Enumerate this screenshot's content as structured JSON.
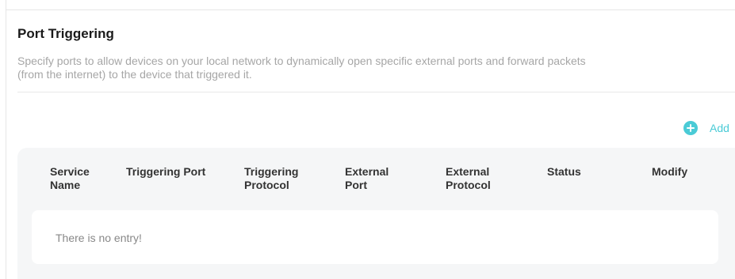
{
  "section": {
    "title": "Port Triggering",
    "description_line1": "Specify ports to allow devices on your local network to dynamically open specific external ports and forward packets",
    "description_line2": "(from the internet) to the device that triggered it."
  },
  "toolbar": {
    "add_label": "Add",
    "add_icon": "plus-circle-icon",
    "accent_color": "#4acbd6"
  },
  "table": {
    "columns": [
      {
        "line1": "Service",
        "line2": "Name"
      },
      {
        "line1": "Triggering Port",
        "line2": ""
      },
      {
        "line1": "Triggering",
        "line2": "Protocol"
      },
      {
        "line1": "External",
        "line2": "Port"
      },
      {
        "line1": "External",
        "line2": "Protocol"
      },
      {
        "line1": "Status",
        "line2": ""
      },
      {
        "line1": "Modify",
        "line2": ""
      }
    ],
    "rows": [],
    "empty_message": "There is no entry!"
  }
}
